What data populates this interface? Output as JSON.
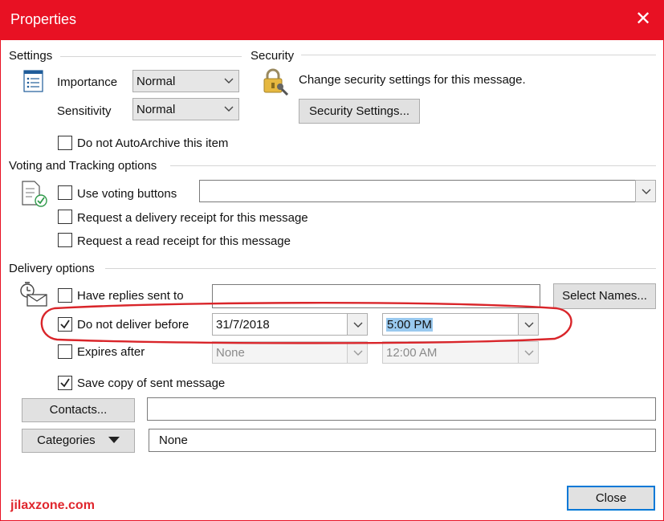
{
  "window": {
    "title": "Properties",
    "close_glyph": "✕"
  },
  "settings": {
    "heading": "Settings",
    "importance_label": "Importance",
    "importance_value": "Normal",
    "sensitivity_label": "Sensitivity",
    "sensitivity_value": "Normal",
    "autoarchive_label": "Do not AutoArchive this item",
    "autoarchive_checked": false
  },
  "security": {
    "heading": "Security",
    "description": "Change security settings for this message.",
    "button_label": "Security Settings..."
  },
  "voting": {
    "heading": "Voting and Tracking options",
    "use_voting_label": "Use voting buttons",
    "use_voting_value": "",
    "delivery_receipt_label": "Request a delivery receipt for this message",
    "read_receipt_label": "Request a read receipt for this message"
  },
  "delivery": {
    "heading": "Delivery options",
    "replies_label": "Have replies sent to",
    "replies_value": "",
    "select_names_label": "Select Names...",
    "do_not_deliver_label": "Do not deliver before",
    "do_not_deliver_checked": true,
    "deliver_date": "31/7/2018",
    "deliver_time": "5:00 PM",
    "expires_label": "Expires after",
    "expires_date": "None",
    "expires_time": "12:00 AM",
    "save_copy_label": "Save copy of sent message",
    "save_copy_checked": true
  },
  "contacts": {
    "button_label": "Contacts...",
    "value": ""
  },
  "categories": {
    "button_label": "Categories",
    "value": "None"
  },
  "footer": {
    "close_label": "Close",
    "watermark": "jilaxzone.com"
  },
  "colors": {
    "title_bar": "#e81123",
    "annotation_circle": "#d9252a",
    "watermark": "#e0262d",
    "default_button_border": "#0078d7"
  }
}
